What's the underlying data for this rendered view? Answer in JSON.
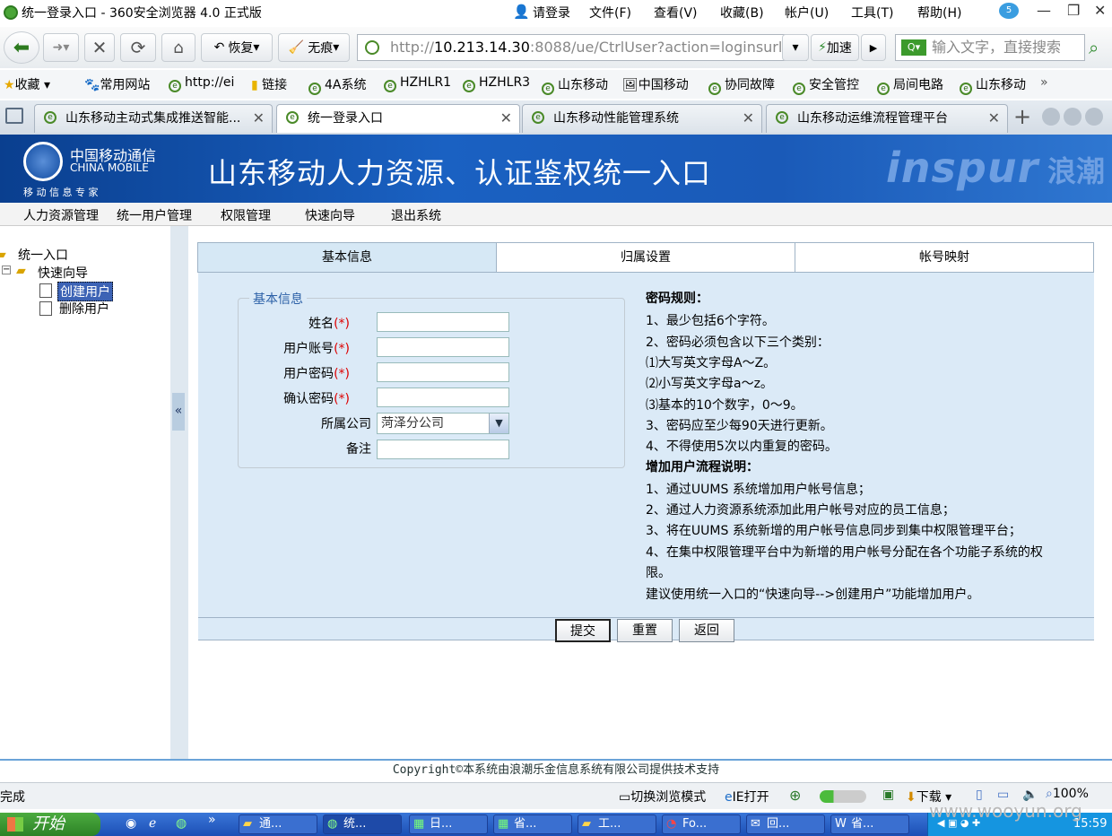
{
  "window": {
    "title": "统一登录入口 - 360安全浏览器 4.0 正式版",
    "login": "请登录"
  },
  "menu": [
    "文件(F)",
    "查看(V)",
    "收藏(B)",
    "帐户(U)",
    "工具(T)",
    "帮助(H)"
  ],
  "notify_count": "5",
  "nav": {
    "restore": "恢复",
    "incognito": "无痕",
    "url_prefix": "http://",
    "url_host": "10.213.14.30",
    "url_rest": ":8088/ue/CtrlUser?action=loginsurl=",
    "accelerate": "加速",
    "search_placeholder": "输入文字，直接搜索"
  },
  "favorites": [
    "收藏",
    "常用网站",
    "http://ei",
    "链接",
    "4A系统",
    "HZHLR1",
    "HZHLR3",
    "山东移动",
    "中国移动",
    "协同故障",
    "安全管控",
    "局间电路",
    "山东移动"
  ],
  "tabs": [
    {
      "label": "山东移动主动式集成推送智能..."
    },
    {
      "label": "统一登录入口"
    },
    {
      "label": "山东移动性能管理系统"
    },
    {
      "label": "山东移动运维流程管理平台"
    }
  ],
  "banner": {
    "logo_cn": "中国移动通信",
    "logo_en": "CHINA MOBILE",
    "logo_slogan": "移 动 信 息 专 家",
    "title": "山东移动人力资源、认证鉴权统一入口",
    "brand": "inspur",
    "brand_cn": "浪潮"
  },
  "modules": [
    "人力资源管理",
    "统一用户管理",
    "权限管理",
    "快速向导",
    "退出系统"
  ],
  "tree": {
    "root": "统一入口",
    "folder": "快速向导",
    "items": [
      "创建用户",
      "删除用户"
    ]
  },
  "page_tabs": [
    "基本信息",
    "归属设置",
    "帐号映射"
  ],
  "form": {
    "legend": "基本信息",
    "required_mark": "(*)",
    "fields": [
      {
        "label": "姓名",
        "required": true,
        "value": ""
      },
      {
        "label": "用户账号",
        "required": true,
        "value": ""
      },
      {
        "label": "用户密码",
        "required": true,
        "value": ""
      },
      {
        "label": "确认密码",
        "required": true,
        "value": ""
      },
      {
        "label": "所属公司",
        "required": false,
        "value": "菏泽分公司"
      },
      {
        "label": "备注",
        "required": false,
        "value": ""
      }
    ]
  },
  "rules": {
    "pw_title": "密码规则：",
    "pw_lines": [
      "1、最少包括6个字符。",
      "2、密码必须包含以下三个类别：",
      " ⑴大写英文字母A～Z。",
      " ⑵小写英文字母a～z。",
      " ⑶基本的10个数字，0～9。",
      "3、密码应至少每90天进行更新。",
      "4、不得使用5次以内重复的密码。"
    ],
    "flow_title": "增加用户流程说明：",
    "flow_lines": [
      "  1、通过UUMS 系统增加用户帐号信息；",
      "  2、通过人力资源系统添加此用户帐号对应的员工信息；",
      "  3、将在UUMS 系统新增的用户帐号信息同步到集中权限管理平台；",
      "  4、在集中权限管理平台中为新增的用户帐号分配在各个功能子系统的权",
      "限。",
      "  建议使用统一入口的“快速向导-->创建用户”功能增加用户。"
    ]
  },
  "buttons": {
    "submit": "提交",
    "reset": "重置",
    "back": "返回"
  },
  "copyright": "Copyright©本系统由浪潮乐金信息系统有限公司提供技术支持",
  "status": {
    "done": "完成",
    "switch_mode": "切换浏览模式",
    "ie_open": "IE打开",
    "download": "下载",
    "zoom": "100%"
  },
  "taskbar": {
    "start": "开始",
    "tasks": [
      "通...",
      "统...",
      "日...",
      "省...",
      "工...",
      "Fo...",
      "回...",
      "省..."
    ],
    "clock": "15:59"
  },
  "watermark": "www.wooyun.org",
  "colors": {
    "banner": "#1a5ab8",
    "panel": "#dbeaf7",
    "required": "#dd0000"
  }
}
